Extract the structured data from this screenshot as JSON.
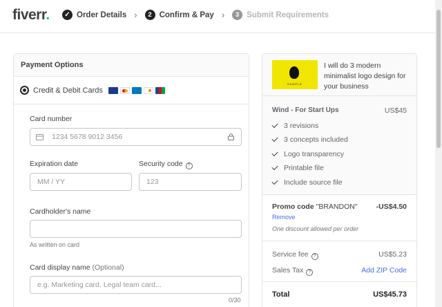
{
  "header": {
    "logo_text": "fiverr",
    "logo_dot": ".",
    "steps": [
      {
        "num": "✓",
        "label": "Order Details"
      },
      {
        "num": "2",
        "label": "Confirm & Pay"
      },
      {
        "num": "3",
        "label": "Submit Requirements"
      }
    ]
  },
  "payment": {
    "title": "Payment Options",
    "option_label": "Credit & Debit Cards",
    "card_number_label": "Card number",
    "card_number_placeholder": "1234 5678 9012 3456",
    "expiration_label": "Expiration date",
    "expiration_placeholder": "MM / YY",
    "security_label": "Security code",
    "security_placeholder": "123",
    "cardholder_label": "Cardholder's name",
    "cardholder_placeholder": "",
    "cardholder_help": "As written on card",
    "display_name_label": "Card display name",
    "display_name_optional": "(Optional)",
    "display_name_placeholder": "e.g. Marketing card, Legal team card...",
    "display_name_count": "0/30"
  },
  "summary": {
    "gig_title": "I will do 3 modern minimalist logo design for your business",
    "package_name": "Wind - For Start Ups",
    "package_price": "US$45",
    "features": [
      "3 revisions",
      "3 concepts included",
      "Logo transparency",
      "Printable file",
      "Include source file"
    ],
    "promo_label": "Promo code",
    "promo_code": "\"BRANDON\"",
    "promo_amount": "-US$4.50",
    "remove_label": "Remove",
    "promo_note": "One discount allowed per order",
    "service_fee_label": "Service fee",
    "service_fee_value": "US$5.23",
    "sales_tax_label": "Sales Tax",
    "sales_tax_action": "Add ZIP Code",
    "total_label": "Total",
    "total_value": "US$45.73"
  }
}
